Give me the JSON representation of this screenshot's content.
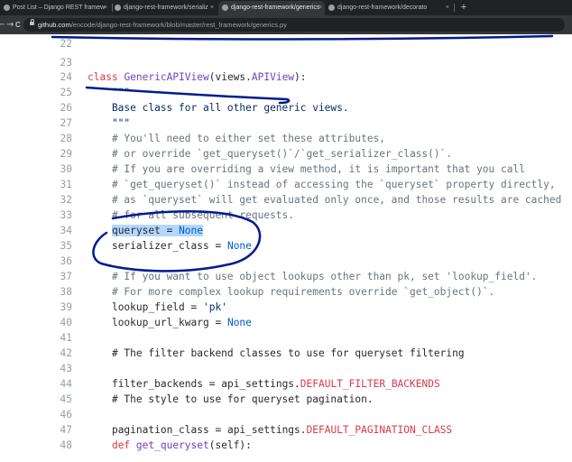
{
  "browser": {
    "tabs": [
      {
        "title": "Post List – Django REST framew",
        "active": false
      },
      {
        "title": "django-rest-framework/serializ",
        "active": false
      },
      {
        "title": "django-rest-framework/generics",
        "active": true
      },
      {
        "title": "django-rest-framework/decorato",
        "active": false
      }
    ],
    "close_glyph": "×",
    "new_tab_glyph": "+",
    "back_glyph": "←",
    "forward_glyph": "→",
    "reload_glyph": "C",
    "url_host": "github.com",
    "url_path": "/encode/django-rest-framework/blob/master/rest_framework/generics.py"
  },
  "code": {
    "lines": [
      {
        "num": "22",
        "text": ""
      },
      {
        "num": "23",
        "text": ""
      },
      {
        "num": "24",
        "text": ""
      },
      {
        "num": "25",
        "text": "    \"\"\""
      },
      {
        "num": "26",
        "text": "    Base class for all other generic views."
      },
      {
        "num": "27",
        "text": "    \"\"\""
      },
      {
        "num": "28",
        "text": "    # You'll need to either set these attributes,"
      },
      {
        "num": "29",
        "text": "    # or override `get_queryset()`/`get_serializer_class()`."
      },
      {
        "num": "30",
        "text": "    # If you are overriding a view method, it is important that you call"
      },
      {
        "num": "31",
        "text": "    # `get_queryset()` instead of accessing the `queryset` property directly,"
      },
      {
        "num": "32",
        "text": "    # as `queryset` will get evaluated only once, and those results are cached"
      },
      {
        "num": "33",
        "text": "    # for all subsequent requests."
      },
      {
        "num": "34",
        "text": ""
      },
      {
        "num": "35",
        "text": ""
      },
      {
        "num": "36",
        "text": ""
      },
      {
        "num": "37",
        "text": "    # If you want to use object lookups other than pk, set 'lookup_field'."
      },
      {
        "num": "38",
        "text": "    # For more complex lookup requirements override `get_object()`."
      },
      {
        "num": "39",
        "text": ""
      },
      {
        "num": "40",
        "text": ""
      },
      {
        "num": "41",
        "text": ""
      },
      {
        "num": "42",
        "text": "    # The filter backend classes to use for queryset filtering"
      },
      {
        "num": "43",
        "text": ""
      },
      {
        "num": "44",
        "text": ""
      },
      {
        "num": "45",
        "text": "    # The style to use for queryset pagination."
      },
      {
        "num": "46",
        "text": ""
      },
      {
        "num": "47",
        "text": ""
      },
      {
        "num": "48",
        "text": ""
      }
    ],
    "tokens": {
      "class_kw": "class",
      "class_name": "GenericAPIView",
      "class_base_open": "(views.",
      "class_base": "APIView",
      "class_base_close": "):",
      "queryset_name": "queryset",
      "queryset_eq": " = ",
      "none_value": "None",
      "serializer_name": "serializer_class",
      "lookup_field_name": "lookup_field",
      "lookup_field_value": "'pk'",
      "lookup_url_kwarg_name": "lookup_url_kwarg",
      "filter_backends_name": "filter_backends",
      "filter_backends_value": "DEFAULT_FILTER_BACKENDS",
      "pagination_class_name": "pagination_class",
      "pagination_class_value": "DEFAULT_PAGINATION_CLASS",
      "api_settings": "api_settings.",
      "def_kw": "def",
      "def_name": "get_queryset",
      "def_args": "(self):"
    }
  },
  "colors": {
    "keyword": "#d73a49",
    "function": "#6f42c1",
    "comment": "#6a737d",
    "string": "#032f62",
    "constant": "#005cc5",
    "ink": "#001b8f"
  }
}
